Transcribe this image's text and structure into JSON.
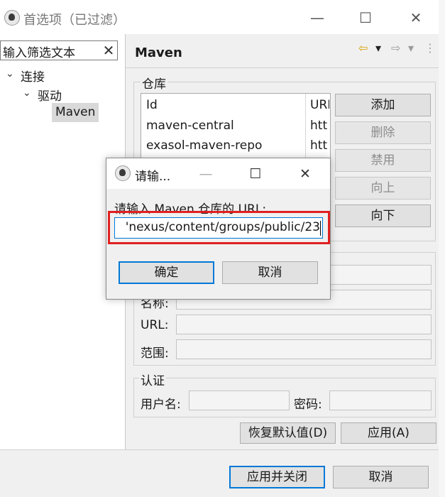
{
  "window": {
    "title": "首选项（已过滤）",
    "minimize": "—",
    "maximize": "☐",
    "close": "✕"
  },
  "sidebar": {
    "filter_value": "输入筛选文本",
    "clear_icon": "✕",
    "tree": [
      {
        "label": "连接",
        "chevron": "⌄"
      },
      {
        "label": "驱动",
        "chevron": "⌄"
      },
      {
        "label": "Maven",
        "chevron": ""
      }
    ]
  },
  "main": {
    "title": "Maven",
    "nav_icons": [
      "⇦",
      "▾",
      "⇨",
      "▾",
      "⋮"
    ],
    "repo_group_label": "仓库",
    "repo_table": {
      "col_id": "Id",
      "col_url": "URL",
      "rows": [
        {
          "id": "maven-central",
          "url": "htt"
        },
        {
          "id": "exasol-maven-repo",
          "url": "htt"
        }
      ]
    },
    "buttons": {
      "add": "添加",
      "remove": "删除",
      "disable": "禁用",
      "up": "向上",
      "down": "向下"
    },
    "fields": {
      "name_label": "名称:",
      "url_label": "URL:",
      "scope_label": "范围:"
    },
    "auth": {
      "group_label": "认证",
      "user_label": "用户名:",
      "pass_label": "密码:"
    },
    "restore_defaults": "恢复默认值(D)",
    "apply": "应用(A)"
  },
  "footer": {
    "apply_close": "应用并关闭",
    "cancel": "取消"
  },
  "dialog": {
    "title": "请输...",
    "minimize": "—",
    "maximize": "☐",
    "close": "✕",
    "prompt": "请输入 Maven 仓库的 URL:",
    "input_value": "'nexus/content/groups/public/23",
    "ok": "确定",
    "cancel": "取消"
  },
  "colors": {
    "highlight": "#e02020",
    "focus": "#0078d7"
  }
}
